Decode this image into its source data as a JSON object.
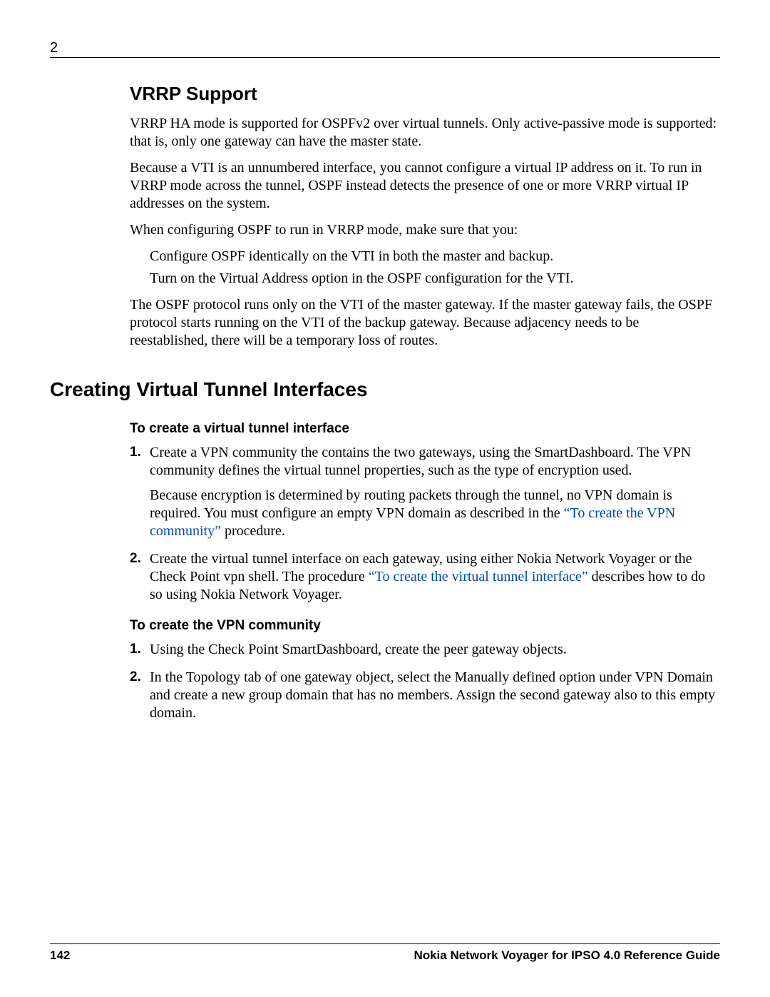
{
  "header": {
    "chapter_number": "2"
  },
  "vrrp": {
    "heading": "VRRP Support",
    "p1": "VRRP HA mode is supported for OSPFv2 over virtual tunnels. Only active-passive mode is supported: that is, only one gateway can have the master state.",
    "p2": "Because a VTI is an unnumbered interface, you cannot configure a virtual IP address on it. To run in VRRP mode across the tunnel, OSPF instead detects the presence of one or more VRRP virtual IP addresses on the system.",
    "p3": "When configuring OSPF to run in VRRP mode, make sure that you:",
    "bullets": [
      "Configure OSPF identically on the VTI in both the master and backup.",
      "Turn on the Virtual Address option in the OSPF configuration for the VTI."
    ],
    "p4": "The OSPF protocol runs only on the VTI of the master gateway. If the master gateway fails, the OSPF protocol starts running on the VTI of the backup gateway. Because adjacency needs to be reestablished, there will be a temporary loss of routes."
  },
  "cvti": {
    "heading": "Creating Virtual Tunnel Interfaces",
    "proc1": {
      "title": "To create a virtual tunnel interface",
      "step1": {
        "num": "1.",
        "text": "Create a VPN community the contains the two gateways, using the SmartDashboard. The VPN community defines the virtual tunnel properties, such as the type of encryption used.",
        "sub_before_link": "Because encryption is determined by routing packets through the tunnel, no VPN domain is required. You must configure an empty VPN domain as described in the ",
        "link": "“To create the VPN community”",
        "sub_after_link": " procedure."
      },
      "step2": {
        "num": "2.",
        "before_link": "Create the virtual tunnel interface on each gateway, using either Nokia Network Voyager or the Check Point vpn shell. The procedure ",
        "link": "“To create the virtual tunnel interface”",
        "after_link": " describes how to do so using Nokia Network Voyager."
      }
    },
    "proc2": {
      "title": "To create the VPN community",
      "step1": {
        "num": "1.",
        "text": "Using the Check Point SmartDashboard, create the peer gateway objects."
      },
      "step2": {
        "num": "2.",
        "text": "In the Topology tab of one gateway object, select the Manually defined option under VPN Domain and create a new group domain that has no members. Assign the second gateway also to this empty domain."
      }
    }
  },
  "footer": {
    "page": "142",
    "book": "Nokia Network Voyager for IPSO 4.0 Reference Guide"
  }
}
